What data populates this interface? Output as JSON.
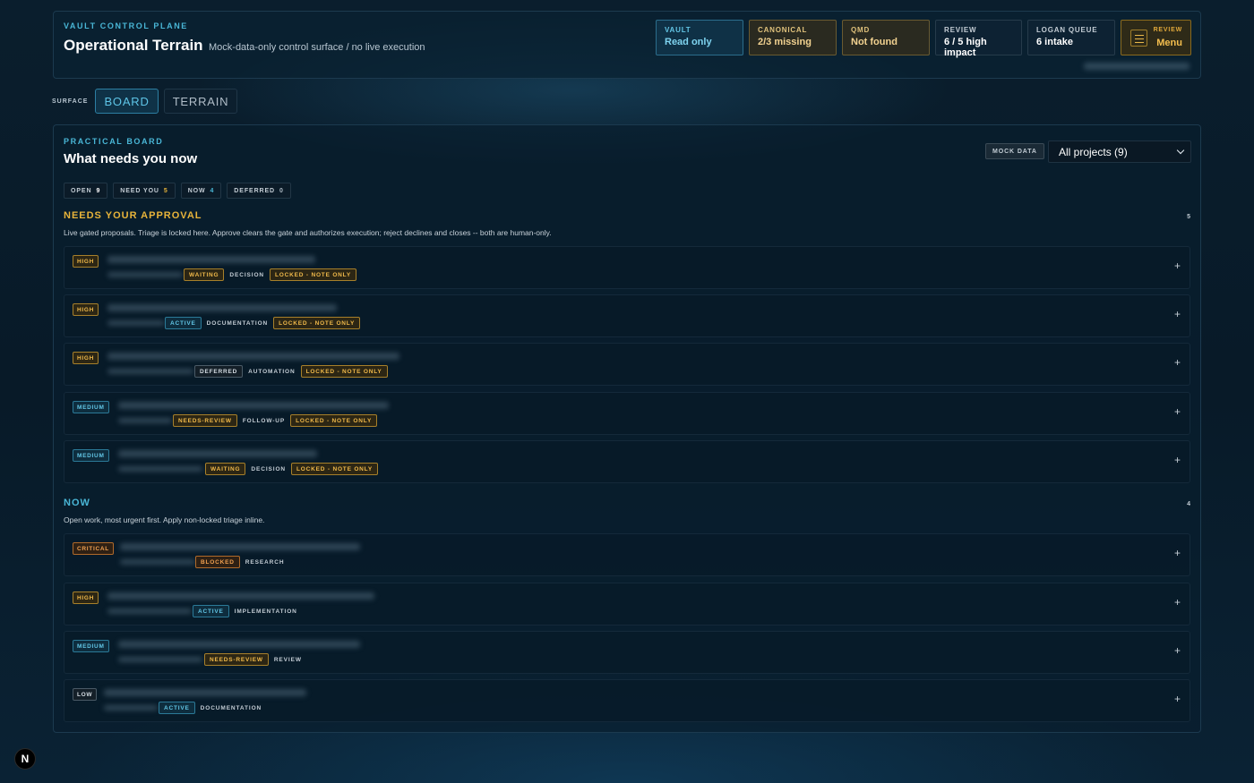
{
  "header": {
    "kicker": "VAULT CONTROL PLANE",
    "title": "Operational Terrain",
    "subtitle": "Mock-data-only control surface / no live execution",
    "stats": [
      {
        "label": "VAULT",
        "value": "Read only"
      },
      {
        "label": "CANONICAL",
        "value": "2/3 missing"
      },
      {
        "label": "QMD",
        "value": "Not found"
      },
      {
        "label": "REVIEW",
        "value": "6 / 5 high impact"
      },
      {
        "label": "LOGAN QUEUE",
        "value": "6 intake"
      }
    ],
    "menu": {
      "label": "REVIEW",
      "value": "Menu"
    }
  },
  "surface": {
    "label": "SURFACE",
    "tabs": [
      "BOARD",
      "TERRAIN"
    ]
  },
  "board": {
    "kicker": "PRACTICAL BOARD",
    "title": "What needs you now",
    "mock_badge": "MOCK DATA",
    "project_select": "All projects (9)",
    "counts": [
      {
        "label": "OPEN",
        "value": "9"
      },
      {
        "label": "NEED YOU",
        "value": "5"
      },
      {
        "label": "NOW",
        "value": "4"
      },
      {
        "label": "DEFERRED",
        "value": "0"
      }
    ]
  },
  "sections": {
    "approval": {
      "title": "NEEDS YOUR APPROVAL",
      "description": "Live gated proposals. Triage is locked here. Approve clears the gate and authorizes execution; reject declines and closes -- both are human-only.",
      "count": "5",
      "items": [
        {
          "priority": "HIGH",
          "status": "WAITING",
          "category": "DECISION",
          "lock": "LOCKED - NOTE ONLY"
        },
        {
          "priority": "HIGH",
          "status": "ACTIVE",
          "category": "DOCUMENTATION",
          "lock": "LOCKED - NOTE ONLY"
        },
        {
          "priority": "HIGH",
          "status": "DEFERRED",
          "category": "AUTOMATION",
          "lock": "LOCKED - NOTE ONLY"
        },
        {
          "priority": "MEDIUM",
          "status": "NEEDS-REVIEW",
          "category": "FOLLOW-UP",
          "lock": "LOCKED - NOTE ONLY"
        },
        {
          "priority": "MEDIUM",
          "status": "WAITING",
          "category": "DECISION",
          "lock": "LOCKED - NOTE ONLY"
        }
      ]
    },
    "now": {
      "title": "NOW",
      "description": "Open work, most urgent first. Apply non-locked triage inline.",
      "count": "4",
      "items": [
        {
          "priority": "CRITICAL",
          "status": "BLOCKED",
          "category": "RESEARCH"
        },
        {
          "priority": "HIGH",
          "status": "ACTIVE",
          "category": "IMPLEMENTATION"
        },
        {
          "priority": "MEDIUM",
          "status": "NEEDS-REVIEW",
          "category": "REVIEW"
        },
        {
          "priority": "LOW",
          "status": "ACTIVE",
          "category": "DOCUMENTATION"
        }
      ]
    }
  },
  "expand_glyph": "+",
  "logo_letter": "N"
}
